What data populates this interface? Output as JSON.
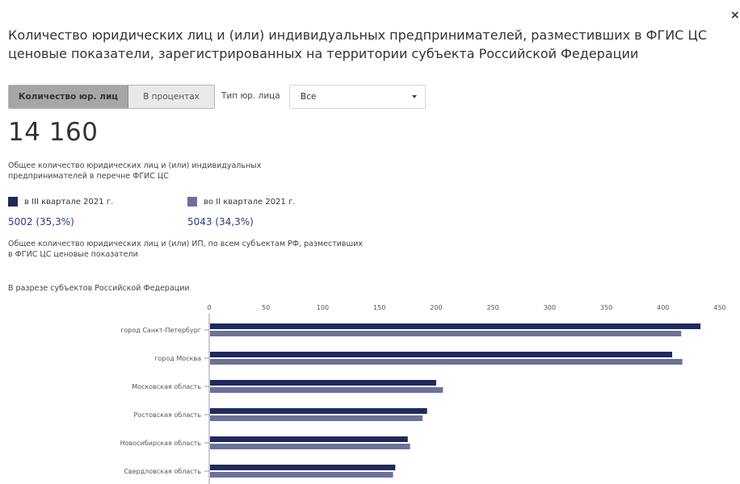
{
  "dialog": {
    "close_glyph": "×",
    "title": "Количество юридических лиц и (или) индивидуальных предпринимателей, разместивших в ФГИС ЦС ценовые показатели, зарегистрированных на территории субъекта Российской Федерации"
  },
  "controls": {
    "toggle_count_label": "Количество юр. лиц",
    "toggle_percent_label": "В процентах",
    "type_label": "Тип юр. лица",
    "type_select_value": "Все"
  },
  "summary": {
    "total": "14 160",
    "total_description": "Общее количество юридических лиц и (или) индивидуальных предпринимателей в перечне ФГИС ЦС",
    "legend": [
      {
        "label": "в III квартале 2021 г.",
        "value": "5002 (35,3%)",
        "color": "#1f2a5c"
      },
      {
        "label": "во II квартале 2021 г.",
        "value": "5043 (34,3%)",
        "color": "#6d7199"
      }
    ],
    "subjects_description": "Общее количество юридических лиц и (или) ИП, по всем субъектам РФ, разместивших в ФГИС ЦС ценовые показатели"
  },
  "section_title": "В разрезе субъектов Российской Федерации",
  "chart_data": {
    "type": "bar",
    "orientation": "horizontal",
    "xlim": [
      0,
      450
    ],
    "ticks": [
      0,
      50,
      100,
      150,
      200,
      250,
      300,
      350,
      400,
      450
    ],
    "tick_labels": [
      "0",
      "50",
      "100",
      "150",
      "200",
      "250",
      "300",
      "350",
      "400",
      "450"
    ],
    "categories": [
      "город Санкт-Петербург",
      "город Москва",
      "Московская область",
      "Ростовская область",
      "Новосибирская область",
      "Свердловская область"
    ],
    "series": [
      {
        "name": "в III квартале 2021 г.",
        "color": "#1f2a5c",
        "values": [
          433,
          408,
          200,
          192,
          175,
          164
        ]
      },
      {
        "name": "во II квартале 2021 г.",
        "color": "#6d7199",
        "values": [
          416,
          417,
          206,
          188,
          177,
          162
        ]
      }
    ],
    "grid": false
  }
}
